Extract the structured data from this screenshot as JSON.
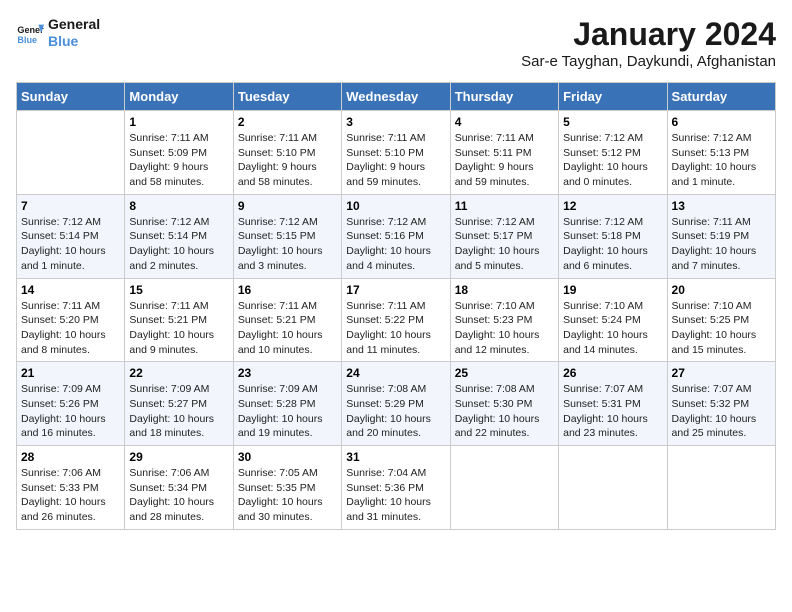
{
  "logo": {
    "text_general": "General",
    "text_blue": "Blue"
  },
  "title": "January 2024",
  "subtitle": "Sar-e Tayghan, Daykundi, Afghanistan",
  "days_of_week": [
    "Sunday",
    "Monday",
    "Tuesday",
    "Wednesday",
    "Thursday",
    "Friday",
    "Saturday"
  ],
  "weeks": [
    [
      {
        "day": "",
        "info": ""
      },
      {
        "day": "1",
        "info": "Sunrise: 7:11 AM\nSunset: 5:09 PM\nDaylight: 9 hours\nand 58 minutes."
      },
      {
        "day": "2",
        "info": "Sunrise: 7:11 AM\nSunset: 5:10 PM\nDaylight: 9 hours\nand 58 minutes."
      },
      {
        "day": "3",
        "info": "Sunrise: 7:11 AM\nSunset: 5:10 PM\nDaylight: 9 hours\nand 59 minutes."
      },
      {
        "day": "4",
        "info": "Sunrise: 7:11 AM\nSunset: 5:11 PM\nDaylight: 9 hours\nand 59 minutes."
      },
      {
        "day": "5",
        "info": "Sunrise: 7:12 AM\nSunset: 5:12 PM\nDaylight: 10 hours\nand 0 minutes."
      },
      {
        "day": "6",
        "info": "Sunrise: 7:12 AM\nSunset: 5:13 PM\nDaylight: 10 hours\nand 1 minute."
      }
    ],
    [
      {
        "day": "7",
        "info": "Sunrise: 7:12 AM\nSunset: 5:14 PM\nDaylight: 10 hours\nand 1 minute."
      },
      {
        "day": "8",
        "info": "Sunrise: 7:12 AM\nSunset: 5:14 PM\nDaylight: 10 hours\nand 2 minutes."
      },
      {
        "day": "9",
        "info": "Sunrise: 7:12 AM\nSunset: 5:15 PM\nDaylight: 10 hours\nand 3 minutes."
      },
      {
        "day": "10",
        "info": "Sunrise: 7:12 AM\nSunset: 5:16 PM\nDaylight: 10 hours\nand 4 minutes."
      },
      {
        "day": "11",
        "info": "Sunrise: 7:12 AM\nSunset: 5:17 PM\nDaylight: 10 hours\nand 5 minutes."
      },
      {
        "day": "12",
        "info": "Sunrise: 7:12 AM\nSunset: 5:18 PM\nDaylight: 10 hours\nand 6 minutes."
      },
      {
        "day": "13",
        "info": "Sunrise: 7:11 AM\nSunset: 5:19 PM\nDaylight: 10 hours\nand 7 minutes."
      }
    ],
    [
      {
        "day": "14",
        "info": "Sunrise: 7:11 AM\nSunset: 5:20 PM\nDaylight: 10 hours\nand 8 minutes."
      },
      {
        "day": "15",
        "info": "Sunrise: 7:11 AM\nSunset: 5:21 PM\nDaylight: 10 hours\nand 9 minutes."
      },
      {
        "day": "16",
        "info": "Sunrise: 7:11 AM\nSunset: 5:21 PM\nDaylight: 10 hours\nand 10 minutes."
      },
      {
        "day": "17",
        "info": "Sunrise: 7:11 AM\nSunset: 5:22 PM\nDaylight: 10 hours\nand 11 minutes."
      },
      {
        "day": "18",
        "info": "Sunrise: 7:10 AM\nSunset: 5:23 PM\nDaylight: 10 hours\nand 12 minutes."
      },
      {
        "day": "19",
        "info": "Sunrise: 7:10 AM\nSunset: 5:24 PM\nDaylight: 10 hours\nand 14 minutes."
      },
      {
        "day": "20",
        "info": "Sunrise: 7:10 AM\nSunset: 5:25 PM\nDaylight: 10 hours\nand 15 minutes."
      }
    ],
    [
      {
        "day": "21",
        "info": "Sunrise: 7:09 AM\nSunset: 5:26 PM\nDaylight: 10 hours\nand 16 minutes."
      },
      {
        "day": "22",
        "info": "Sunrise: 7:09 AM\nSunset: 5:27 PM\nDaylight: 10 hours\nand 18 minutes."
      },
      {
        "day": "23",
        "info": "Sunrise: 7:09 AM\nSunset: 5:28 PM\nDaylight: 10 hours\nand 19 minutes."
      },
      {
        "day": "24",
        "info": "Sunrise: 7:08 AM\nSunset: 5:29 PM\nDaylight: 10 hours\nand 20 minutes."
      },
      {
        "day": "25",
        "info": "Sunrise: 7:08 AM\nSunset: 5:30 PM\nDaylight: 10 hours\nand 22 minutes."
      },
      {
        "day": "26",
        "info": "Sunrise: 7:07 AM\nSunset: 5:31 PM\nDaylight: 10 hours\nand 23 minutes."
      },
      {
        "day": "27",
        "info": "Sunrise: 7:07 AM\nSunset: 5:32 PM\nDaylight: 10 hours\nand 25 minutes."
      }
    ],
    [
      {
        "day": "28",
        "info": "Sunrise: 7:06 AM\nSunset: 5:33 PM\nDaylight: 10 hours\nand 26 minutes."
      },
      {
        "day": "29",
        "info": "Sunrise: 7:06 AM\nSunset: 5:34 PM\nDaylight: 10 hours\nand 28 minutes."
      },
      {
        "day": "30",
        "info": "Sunrise: 7:05 AM\nSunset: 5:35 PM\nDaylight: 10 hours\nand 30 minutes."
      },
      {
        "day": "31",
        "info": "Sunrise: 7:04 AM\nSunset: 5:36 PM\nDaylight: 10 hours\nand 31 minutes."
      },
      {
        "day": "",
        "info": ""
      },
      {
        "day": "",
        "info": ""
      },
      {
        "day": "",
        "info": ""
      }
    ]
  ]
}
